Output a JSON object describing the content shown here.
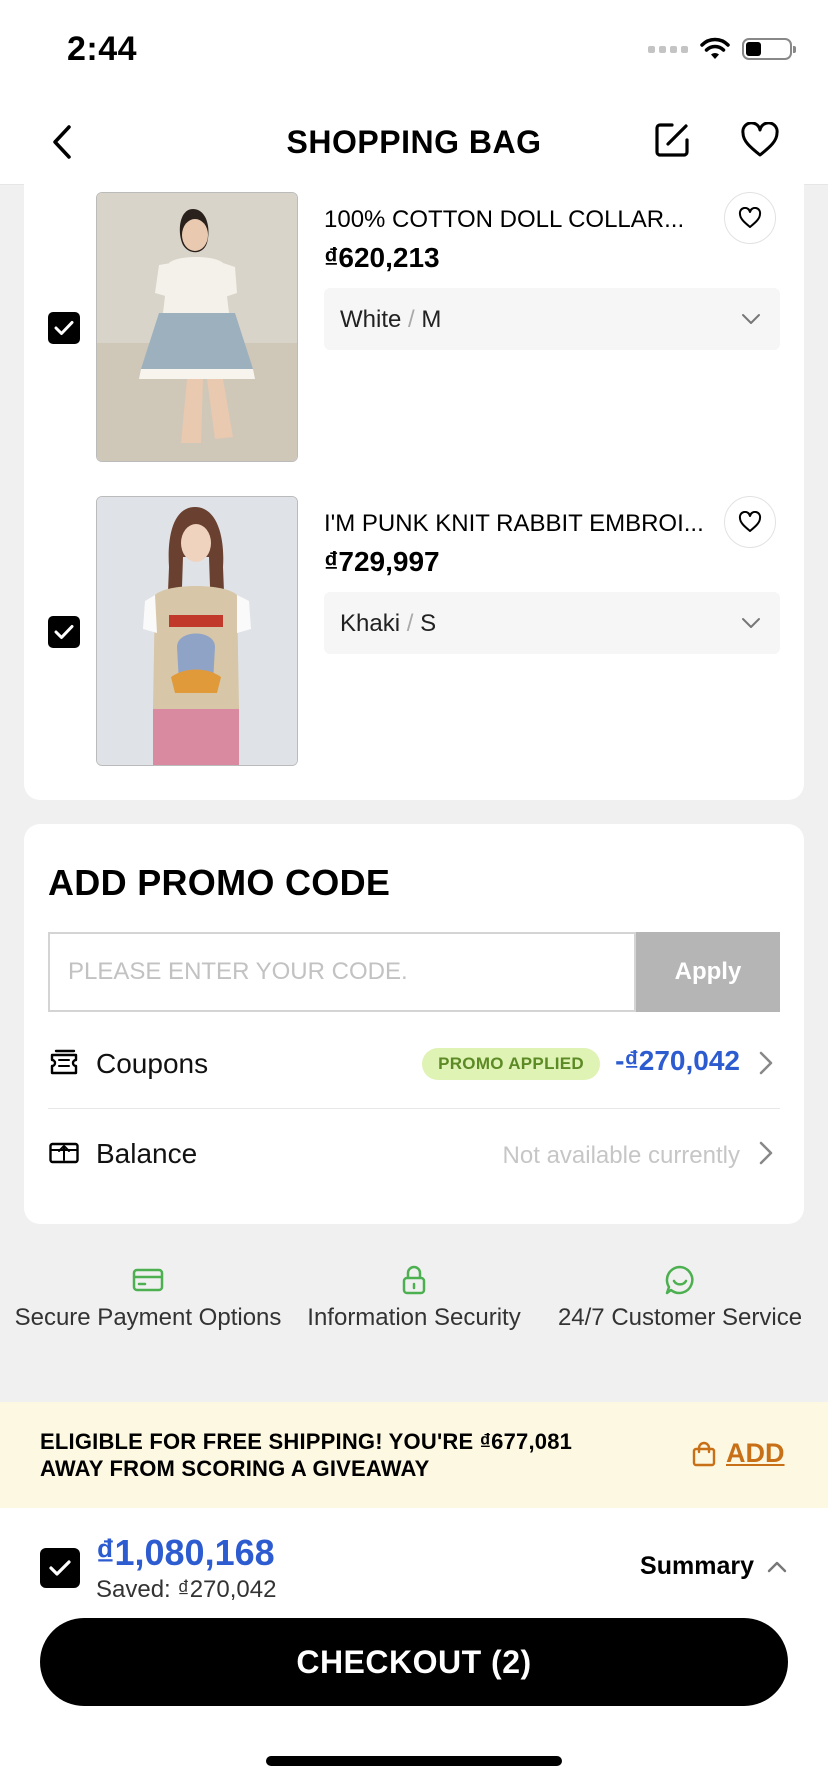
{
  "status_bar": {
    "time": "2:44",
    "battery_level": 0.35
  },
  "nav": {
    "title": "SHOPPING BAG"
  },
  "cart": {
    "items": [
      {
        "name": "100% COTTON DOLL COLLAR...",
        "price": "₫620,213",
        "color": "White",
        "size": "M",
        "selected": true
      },
      {
        "name": "I'M PUNK KNIT RABBIT EMBROI...",
        "price": "₫729,997",
        "color": "Khaki",
        "size": "S",
        "selected": true
      }
    ],
    "variant_separator": "/"
  },
  "promo": {
    "title": "ADD PROMO CODE",
    "placeholder": "PLEASE ENTER YOUR CODE.",
    "apply_label": "Apply",
    "coupons": {
      "label": "Coupons",
      "badge": "PROMO APPLIED",
      "discount": "-₫270,042"
    },
    "balance": {
      "label": "Balance",
      "value": "Not available currently"
    }
  },
  "assurances": [
    {
      "label": "Secure Payment Options",
      "icon": "credit-card-icon"
    },
    {
      "label": "Information Security",
      "icon": "lock-icon"
    },
    {
      "label": "24/7 Customer Service",
      "icon": "chat-bubble-icon"
    }
  ],
  "shipping_banner": {
    "text": "ELIGIBLE FOR FREE SHIPPING! YOU'RE ₫677,081 AWAY FROM SCORING A GIVEAWAY",
    "add_label": "ADD"
  },
  "checkout": {
    "total": "₫1,080,168",
    "saved": "Saved: ₫270,042",
    "summary_label": "Summary",
    "button_label": "CHECKOUT (2)"
  },
  "colors": {
    "accent_blue": "#2d5bd0",
    "promo_green": "#5c8a25",
    "promo_badge_bg": "#dff3b4",
    "assurance_green": "#4caf50",
    "ship_orange": "#c87018",
    "ship_banner_bg": "#fcf8e1"
  }
}
